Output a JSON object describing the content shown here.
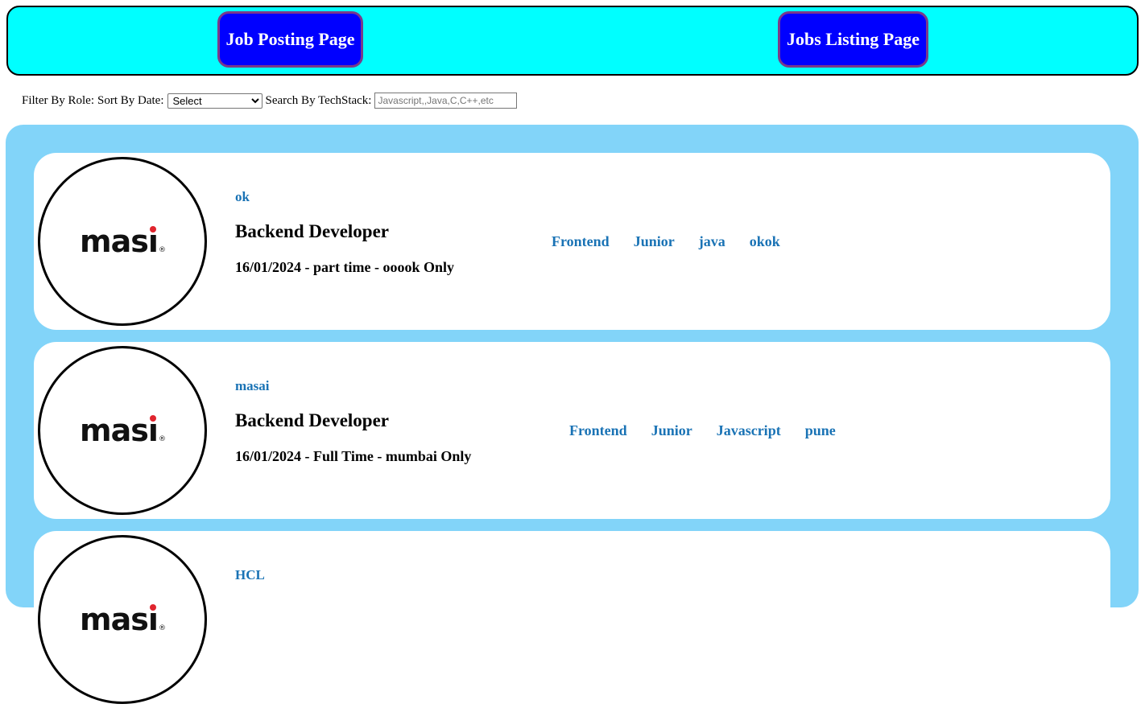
{
  "nav": {
    "posting_label": "Job Posting Page",
    "listing_label": "Jobs Listing Page"
  },
  "filters": {
    "role_label": "Filter By Role:",
    "role_selected": "Select",
    "date_label": "Sort By Date:",
    "date_selected": "Select",
    "search_label": "Search By TechStack:",
    "search_placeholder": "Javascript,,Java,C,C++,etc"
  },
  "jobs": [
    {
      "logo_text": "masai",
      "company": "ok",
      "role": "Backend Developer",
      "meta": "16/01/2024 - part time - ooook Only",
      "tags": [
        "Frontend",
        "Junior",
        "java",
        "okok"
      ]
    },
    {
      "logo_text": "masai",
      "company": "masai",
      "role": "Backend Developer",
      "meta": "16/01/2024 - Full Time - mumbai Only",
      "tags": [
        "Frontend",
        "Junior",
        "Javascript",
        "pune"
      ]
    },
    {
      "logo_text": "masai",
      "company": "HCL",
      "role": "",
      "meta": "",
      "tags": []
    }
  ],
  "colors": {
    "navbar_bg": "#00ffff",
    "nav_button_bg": "#0000ff",
    "panel_bg": "#82d4f9",
    "link_blue": "#1a73b5",
    "logo_dot": "#e0252e"
  }
}
